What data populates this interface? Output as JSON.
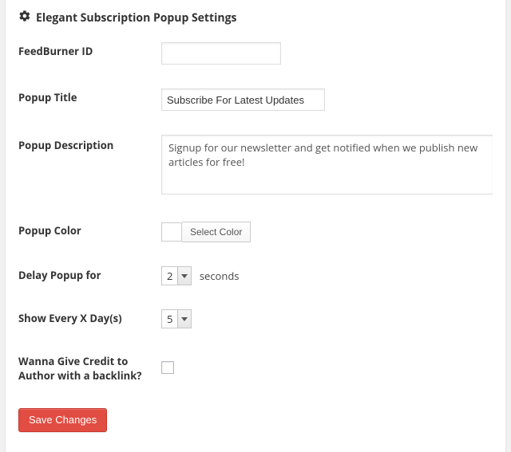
{
  "heading": "Elegant Subscription Popup Settings",
  "fields": {
    "feedburner": {
      "label": "FeedBurner ID",
      "value": ""
    },
    "title": {
      "label": "Popup Title",
      "value": "Subscribe For Latest Updates"
    },
    "description": {
      "label": "Popup Description",
      "value": "Signup for our newsletter and get notified when we publish new articles for free!"
    },
    "color": {
      "label": "Popup Color",
      "button": "Select Color",
      "value": "#ffffff"
    },
    "delay": {
      "label": "Delay Popup for",
      "value": "2",
      "suffix": "seconds"
    },
    "show_every": {
      "label": "Show Every X Day(s)",
      "value": "5"
    },
    "credit": {
      "label": "Wanna Give Credit to Author with a backlink?",
      "checked": false
    }
  },
  "submit": "Save Changes"
}
